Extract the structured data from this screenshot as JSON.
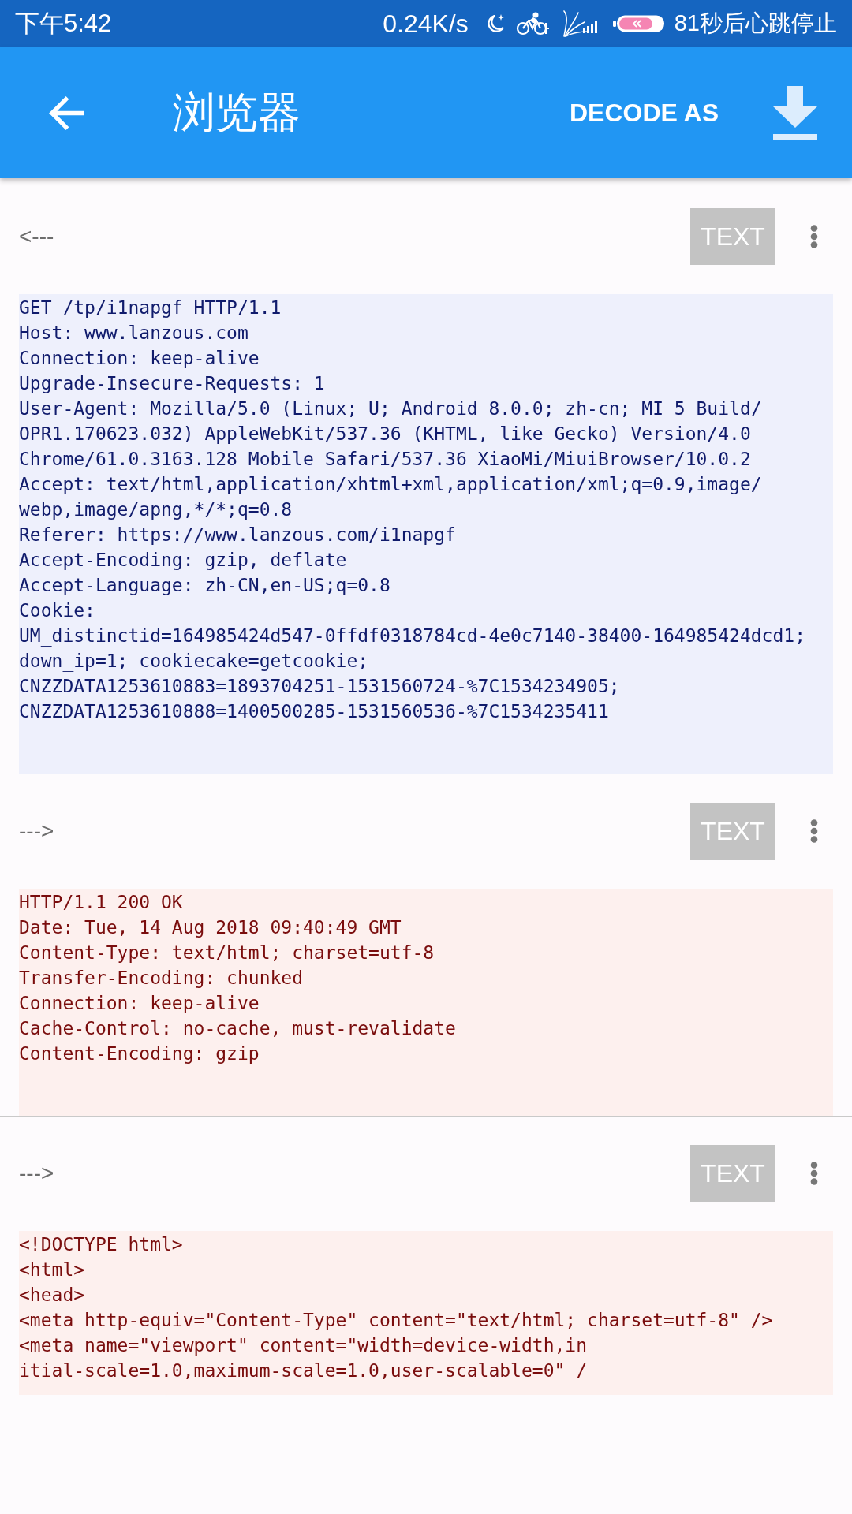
{
  "status_bar": {
    "time": "下午5:42",
    "network_speed": "0.24K/s",
    "notice": "81秒后心跳停止"
  },
  "app_bar": {
    "title": "浏览器",
    "action": "DECODE AS"
  },
  "sections": [
    {
      "kind": "request",
      "direction_label": "<---",
      "format_button": "TEXT",
      "lines": [
        "GET /tp/i1napgf HTTP/1.1",
        "Host: www.lanzous.com",
        "Connection: keep-alive",
        "Upgrade-Insecure-Requests: 1",
        "User-Agent: Mozilla/5.0 (Linux; U; Android 8.0.0; zh-cn; MI 5 Build/",
        "OPR1.170623.032) AppleWebKit/537.36 (KHTML, like Gecko) Version/4.0",
        "Chrome/61.0.3163.128 Mobile Safari/537.36 XiaoMi/MiuiBrowser/10.0.2",
        "Accept: text/html,application/xhtml+xml,application/xml;q=0.9,image/",
        "webp,image/apng,*/*;q=0.8",
        "Referer: https://www.lanzous.com/i1napgf",
        "Accept-Encoding: gzip, deflate",
        "Accept-Language: zh-CN,en-US;q=0.8",
        "Cookie:",
        "UM_distinctid=164985424d547-0ffdf0318784cd-4e0c7140-38400-164985424dcd1;",
        "down_ip=1; cookiecake=getcookie;",
        "CNZZDATA1253610883=1893704251-1531560724-%7C1534234905;",
        "CNZZDATA1253610888=1400500285-1531560536-%7C1534235411"
      ]
    },
    {
      "kind": "response",
      "direction_label": "--->",
      "format_button": "TEXT",
      "lines": [
        "HTTP/1.1 200 OK",
        "Date: Tue, 14 Aug 2018 09:40:49 GMT",
        "Content-Type: text/html; charset=utf-8",
        "Transfer-Encoding: chunked",
        "Connection: keep-alive",
        "Cache-Control: no-cache, must-revalidate",
        "Content-Encoding: gzip"
      ]
    },
    {
      "kind": "response",
      "direction_label": "--->",
      "format_button": "TEXT",
      "lines": [
        "<!DOCTYPE html>",
        "<html>",
        "<head>",
        "<meta http-equiv=\"Content-Type\" content=\"text/html; charset=utf-8\" />",
        "<meta name=\"viewport\" content=\"width=device-width,in",
        "itial-scale=1.0,maximum-scale=1.0,user-scalable=0\" /"
      ]
    }
  ]
}
